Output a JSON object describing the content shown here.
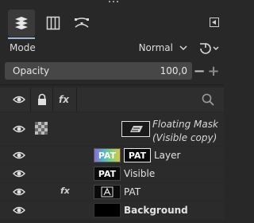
{
  "tabs": [
    {
      "name": "layers",
      "icon": "layers-icon",
      "active": true
    },
    {
      "name": "channels",
      "icon": "channels-icon",
      "active": false
    },
    {
      "name": "paths",
      "icon": "paths-icon",
      "active": false
    }
  ],
  "mode": {
    "label": "Mode",
    "value": "Normal"
  },
  "opacity": {
    "label": "Opacity",
    "value": "100,0",
    "minus": "−",
    "plus": "+"
  },
  "header": {
    "icons": [
      "eye-icon",
      "lock-icon",
      "fx-icon",
      "search-icon"
    ],
    "fx_text": "fx"
  },
  "layers": [
    {
      "name_line1": "Floating Mask",
      "name_line2": "(Visible copy)",
      "floating": true
    },
    {
      "name": "Layer",
      "thumb_text": "PAT",
      "mask_text": "PAT"
    },
    {
      "name": "Visible",
      "thumb_text": "PAT"
    },
    {
      "name": "PAT",
      "has_fx": true,
      "fx_text": "fx"
    },
    {
      "name": "Background",
      "bold": true
    }
  ],
  "colors": {
    "background": "#282828",
    "accent": "#9bb7d8",
    "field": "#474747"
  }
}
